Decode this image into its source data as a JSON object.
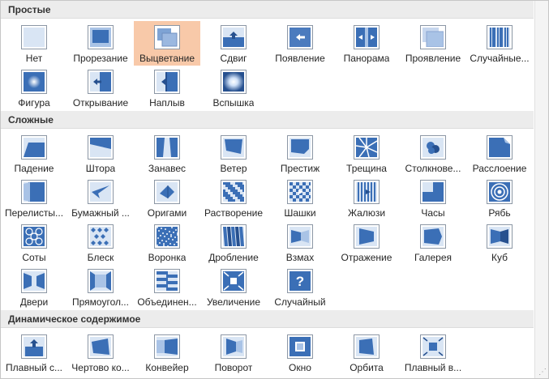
{
  "sections": [
    {
      "title": "Простые",
      "items": [
        {
          "label": "Нет",
          "icon": "none-transition-icon"
        },
        {
          "label": "Прорезание",
          "icon": "cut-transition-icon"
        },
        {
          "label": "Выцветание",
          "icon": "fade-transition-icon",
          "selected": true
        },
        {
          "label": "Сдвиг",
          "icon": "push-transition-icon"
        },
        {
          "label": "Появление",
          "icon": "wipe-transition-icon"
        },
        {
          "label": "Панорама",
          "icon": "split-transition-icon"
        },
        {
          "label": "Проявление",
          "icon": "reveal-transition-icon"
        },
        {
          "label": "Случайные...",
          "icon": "random-bars-transition-icon"
        },
        {
          "label": "Фигура",
          "icon": "shape-transition-icon"
        },
        {
          "label": "Открывание",
          "icon": "uncover-transition-icon"
        },
        {
          "label": "Наплыв",
          "icon": "cover-transition-icon"
        },
        {
          "label": "Вспышка",
          "icon": "flash-transition-icon"
        }
      ]
    },
    {
      "title": "Сложные",
      "items": [
        {
          "label": "Падение",
          "icon": "fall-over-transition-icon"
        },
        {
          "label": "Штора",
          "icon": "drape-transition-icon"
        },
        {
          "label": "Занавес",
          "icon": "curtains-transition-icon"
        },
        {
          "label": "Ветер",
          "icon": "wind-transition-icon"
        },
        {
          "label": "Престиж",
          "icon": "prestige-transition-icon"
        },
        {
          "label": "Трещина",
          "icon": "fracture-transition-icon"
        },
        {
          "label": "Столкнове...",
          "icon": "crush-transition-icon"
        },
        {
          "label": "Расслоение",
          "icon": "peel-off-transition-icon"
        },
        {
          "label": "Перелисты...",
          "icon": "page-curl-transition-icon"
        },
        {
          "label": "Бумажный ...",
          "icon": "airplane-transition-icon"
        },
        {
          "label": "Оригами",
          "icon": "origami-transition-icon"
        },
        {
          "label": "Растворение",
          "icon": "dissolve-transition-icon"
        },
        {
          "label": "Шашки",
          "icon": "checkerboard-transition-icon"
        },
        {
          "label": "Жалюзи",
          "icon": "blinds-transition-icon"
        },
        {
          "label": "Часы",
          "icon": "clock-transition-icon"
        },
        {
          "label": "Рябь",
          "icon": "ripple-transition-icon"
        },
        {
          "label": "Соты",
          "icon": "honeycomb-transition-icon"
        },
        {
          "label": "Блеск",
          "icon": "glitter-transition-icon"
        },
        {
          "label": "Воронка",
          "icon": "vortex-transition-icon"
        },
        {
          "label": "Дробление",
          "icon": "shred-transition-icon"
        },
        {
          "label": "Взмах",
          "icon": "switch-transition-icon"
        },
        {
          "label": "Отражение",
          "icon": "flip-transition-icon"
        },
        {
          "label": "Галерея",
          "icon": "gallery-transition-icon"
        },
        {
          "label": "Куб",
          "icon": "cube-transition-icon"
        },
        {
          "label": "Двери",
          "icon": "doors-transition-icon"
        },
        {
          "label": "Прямоугол...",
          "icon": "box-transition-icon"
        },
        {
          "label": "Объединен...",
          "icon": "comb-transition-icon"
        },
        {
          "label": "Увеличение",
          "icon": "zoom-transition-icon"
        },
        {
          "label": "Случайный",
          "icon": "random-transition-icon",
          "glyph": "?"
        }
      ]
    },
    {
      "title": "Динамическое содержимое",
      "items": [
        {
          "label": "Плавный с...",
          "icon": "pan-transition-icon"
        },
        {
          "label": "Чертово ко...",
          "icon": "ferris-wheel-transition-icon"
        },
        {
          "label": "Конвейер",
          "icon": "conveyor-transition-icon"
        },
        {
          "label": "Поворот",
          "icon": "rotate-transition-icon"
        },
        {
          "label": "Окно",
          "icon": "window-transition-icon"
        },
        {
          "label": "Орбита",
          "icon": "orbit-transition-icon"
        },
        {
          "label": "Плавный в...",
          "icon": "fly-through-transition-icon"
        }
      ]
    }
  ]
}
